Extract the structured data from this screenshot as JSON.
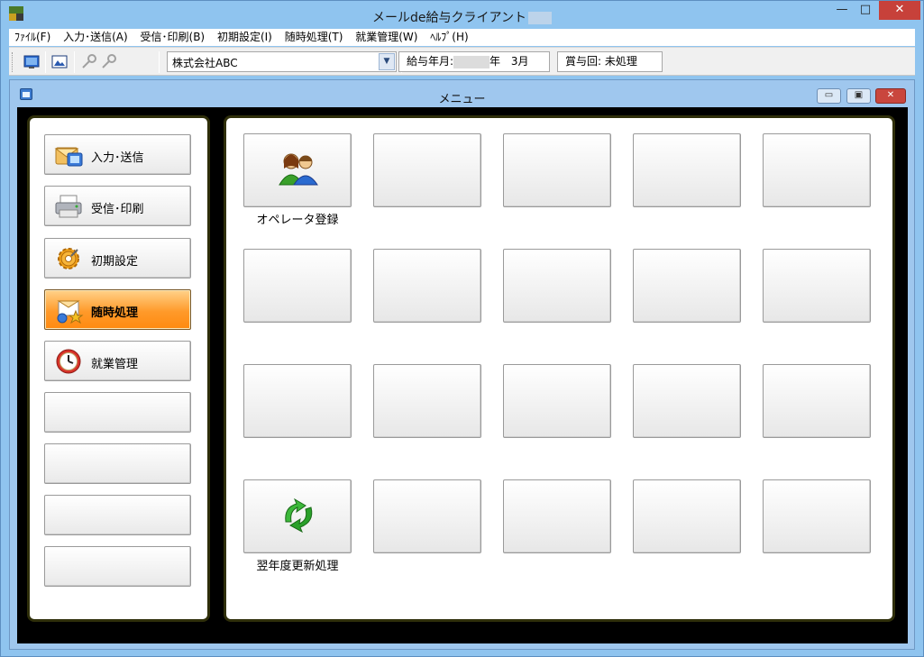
{
  "app": {
    "title": "メールde給与クライアント"
  },
  "window_controls": {
    "minimize": "—",
    "maximize": "□",
    "close": "✕"
  },
  "menubar": {
    "items": [
      {
        "label": "ﾌｧｲﾙ(F)"
      },
      {
        "label": "入力･送信(A)"
      },
      {
        "label": "受信･印刷(B)"
      },
      {
        "label": "初期設定(I)"
      },
      {
        "label": "随時処理(T)"
      },
      {
        "label": "就業管理(W)"
      },
      {
        "label": "ﾍﾙﾌﾟ(H)"
      }
    ]
  },
  "toolbar": {
    "company_select": {
      "value": "株式会社ABC"
    },
    "pay_period": {
      "label": "給与年月:",
      "year_suffix": "年",
      "month": "3月"
    },
    "bonus": {
      "label": "賞与回:",
      "value": "未処理"
    },
    "icons": [
      "monitor-icon",
      "picture-icon",
      "key-icon",
      "key-icon"
    ]
  },
  "child_window": {
    "title": "メニュー",
    "controls": {
      "minimize": "▭",
      "maximize": "▣",
      "close": "✕"
    }
  },
  "sidebar": {
    "items": [
      {
        "label": "入力･送信",
        "icon": "envelope-icon",
        "active": false
      },
      {
        "label": "受信･印刷",
        "icon": "printer-icon",
        "active": false
      },
      {
        "label": "初期設定",
        "icon": "gear-icon",
        "active": false
      },
      {
        "label": "随時処理",
        "icon": "toolbox-icon",
        "active": true
      },
      {
        "label": "就業管理",
        "icon": "clock-icon",
        "active": false
      },
      {
        "label": "",
        "icon": "",
        "active": false
      },
      {
        "label": "",
        "icon": "",
        "active": false
      },
      {
        "label": "",
        "icon": "",
        "active": false
      },
      {
        "label": "",
        "icon": "",
        "active": false
      }
    ]
  },
  "grid": {
    "buttons": [
      {
        "label": "オペレータ登録",
        "icon": "users-icon"
      },
      {
        "label": "",
        "icon": ""
      },
      {
        "label": "",
        "icon": ""
      },
      {
        "label": "",
        "icon": ""
      },
      {
        "label": "",
        "icon": ""
      },
      {
        "label": "",
        "icon": ""
      },
      {
        "label": "",
        "icon": ""
      },
      {
        "label": "",
        "icon": ""
      },
      {
        "label": "",
        "icon": ""
      },
      {
        "label": "",
        "icon": ""
      },
      {
        "label": "",
        "icon": ""
      },
      {
        "label": "",
        "icon": ""
      },
      {
        "label": "",
        "icon": ""
      },
      {
        "label": "",
        "icon": ""
      },
      {
        "label": "",
        "icon": ""
      },
      {
        "label": "翌年度更新処理",
        "icon": "recycle-icon"
      },
      {
        "label": "",
        "icon": ""
      },
      {
        "label": "",
        "icon": ""
      },
      {
        "label": "",
        "icon": ""
      },
      {
        "label": "",
        "icon": ""
      }
    ]
  },
  "colors": {
    "frame": "#8fc4ef",
    "active_button": "#ff9a2a",
    "close_button": "#c7413a"
  }
}
